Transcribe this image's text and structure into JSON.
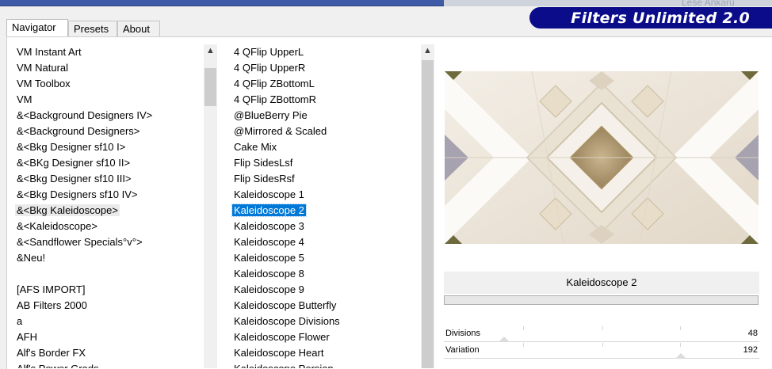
{
  "window": {
    "banner_title": "Filters Unlimited 2.0",
    "background_faint_text": "Lese Ankaru"
  },
  "tabs": [
    {
      "label": "Navigator",
      "active": true
    },
    {
      "label": "Presets",
      "active": false
    },
    {
      "label": "About",
      "active": false
    }
  ],
  "categories": {
    "items": [
      "VM Instant Art",
      "VM Natural",
      "VM Toolbox",
      "VM",
      "&<Background Designers IV>",
      "&<Background Designers>",
      "&<Bkg Designer sf10 I>",
      "&<BKg Designer sf10 II>",
      "&<Bkg Designer sf10 III>",
      "&<Bkg Designers sf10 IV>",
      "&<Bkg Kaleidoscope>",
      "&<Kaleidoscope>",
      "&<Sandflower Specials°v°>",
      "&Neu!",
      "",
      "[AFS IMPORT]",
      "AB Filters 2000",
      "a",
      "AFH",
      "Alf's Border FX",
      "Alf's Power Grads"
    ],
    "highlighted": "&<Bkg Kaleidoscope>"
  },
  "filters": {
    "items": [
      "4 QFlip UpperL",
      "4 QFlip UpperR",
      "4 QFlip ZBottomL",
      "4 QFlip ZBottomR",
      "@BlueBerry Pie",
      "@Mirrored & Scaled",
      "Cake Mix",
      "Flip SidesLsf",
      "Flip SidesRsf",
      "Kaleidoscope 1",
      "Kaleidoscope 2",
      "Kaleidoscope 3",
      "Kaleidoscope 4",
      "Kaleidoscope 5",
      "Kaleidoscope 8",
      "Kaleidoscope 9",
      "Kaleidoscope Butterfly",
      "Kaleidoscope Divisions",
      "Kaleidoscope Flower",
      "Kaleidoscope Heart",
      "Kaleidoscope Persian"
    ],
    "selected": "Kaleidoscope 2"
  },
  "preview": {
    "filter_name": "Kaleidoscope 2"
  },
  "params": [
    {
      "label": "Divisions",
      "value": "48",
      "fraction": 0.19
    },
    {
      "label": "Variation",
      "value": "192",
      "fraction": 0.75
    }
  ],
  "icons": {
    "scroll_up": "chevron-up-icon"
  }
}
